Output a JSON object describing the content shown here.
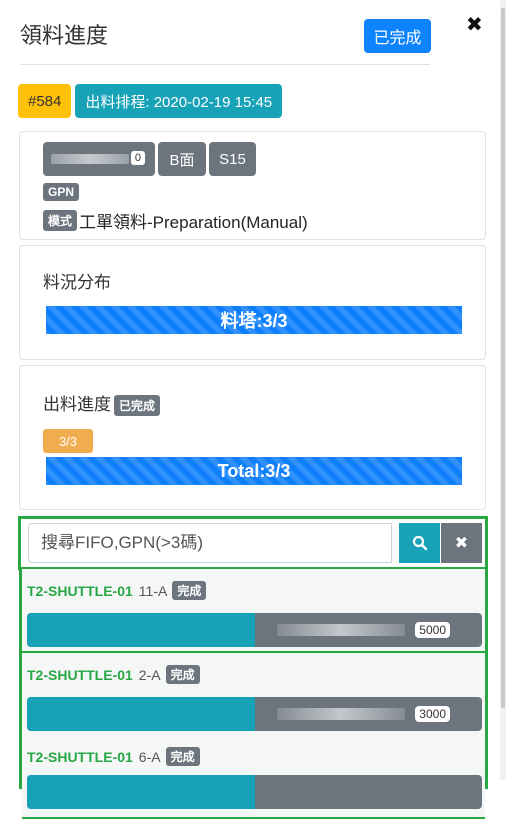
{
  "header": {
    "title": "領料進度",
    "done_label": "已完成",
    "close_icon": "✖"
  },
  "badges": {
    "order_no": "#584",
    "schedule": "出料排程: 2020-02-19 15:45"
  },
  "info": {
    "chip_count": "0",
    "side": "B面",
    "slot": "S15",
    "gpn_tag": "GPN",
    "mode_tag": "模式",
    "mode_text": "工單領料-Preparation(Manual)"
  },
  "distribution": {
    "title": "料況分布",
    "bar_label": "料塔:3/3",
    "progress": 1.0
  },
  "progress": {
    "title": "出料進度",
    "status": "已完成",
    "ratio": "3/3",
    "bar_label": "Total:3/3",
    "progress": 1.0
  },
  "search": {
    "placeholder": "搜尋FIFO,GPN(>3碼)",
    "value": ""
  },
  "list": [
    {
      "name": "T2-SHUTTLE-01",
      "loc": "11-A",
      "status": "完成",
      "qty": "5000"
    },
    {
      "name": "T2-SHUTTLE-01",
      "loc": "2-A",
      "status": "完成",
      "qty": "3000"
    },
    {
      "name": "T2-SHUTTLE-01",
      "loc": "6-A",
      "status": "完成",
      "qty": ""
    }
  ],
  "colors": {
    "primary": "#0d83fd",
    "teal": "#17a2b8",
    "green": "#28a745",
    "yellow": "#ffc107",
    "gray": "#6c757d"
  }
}
